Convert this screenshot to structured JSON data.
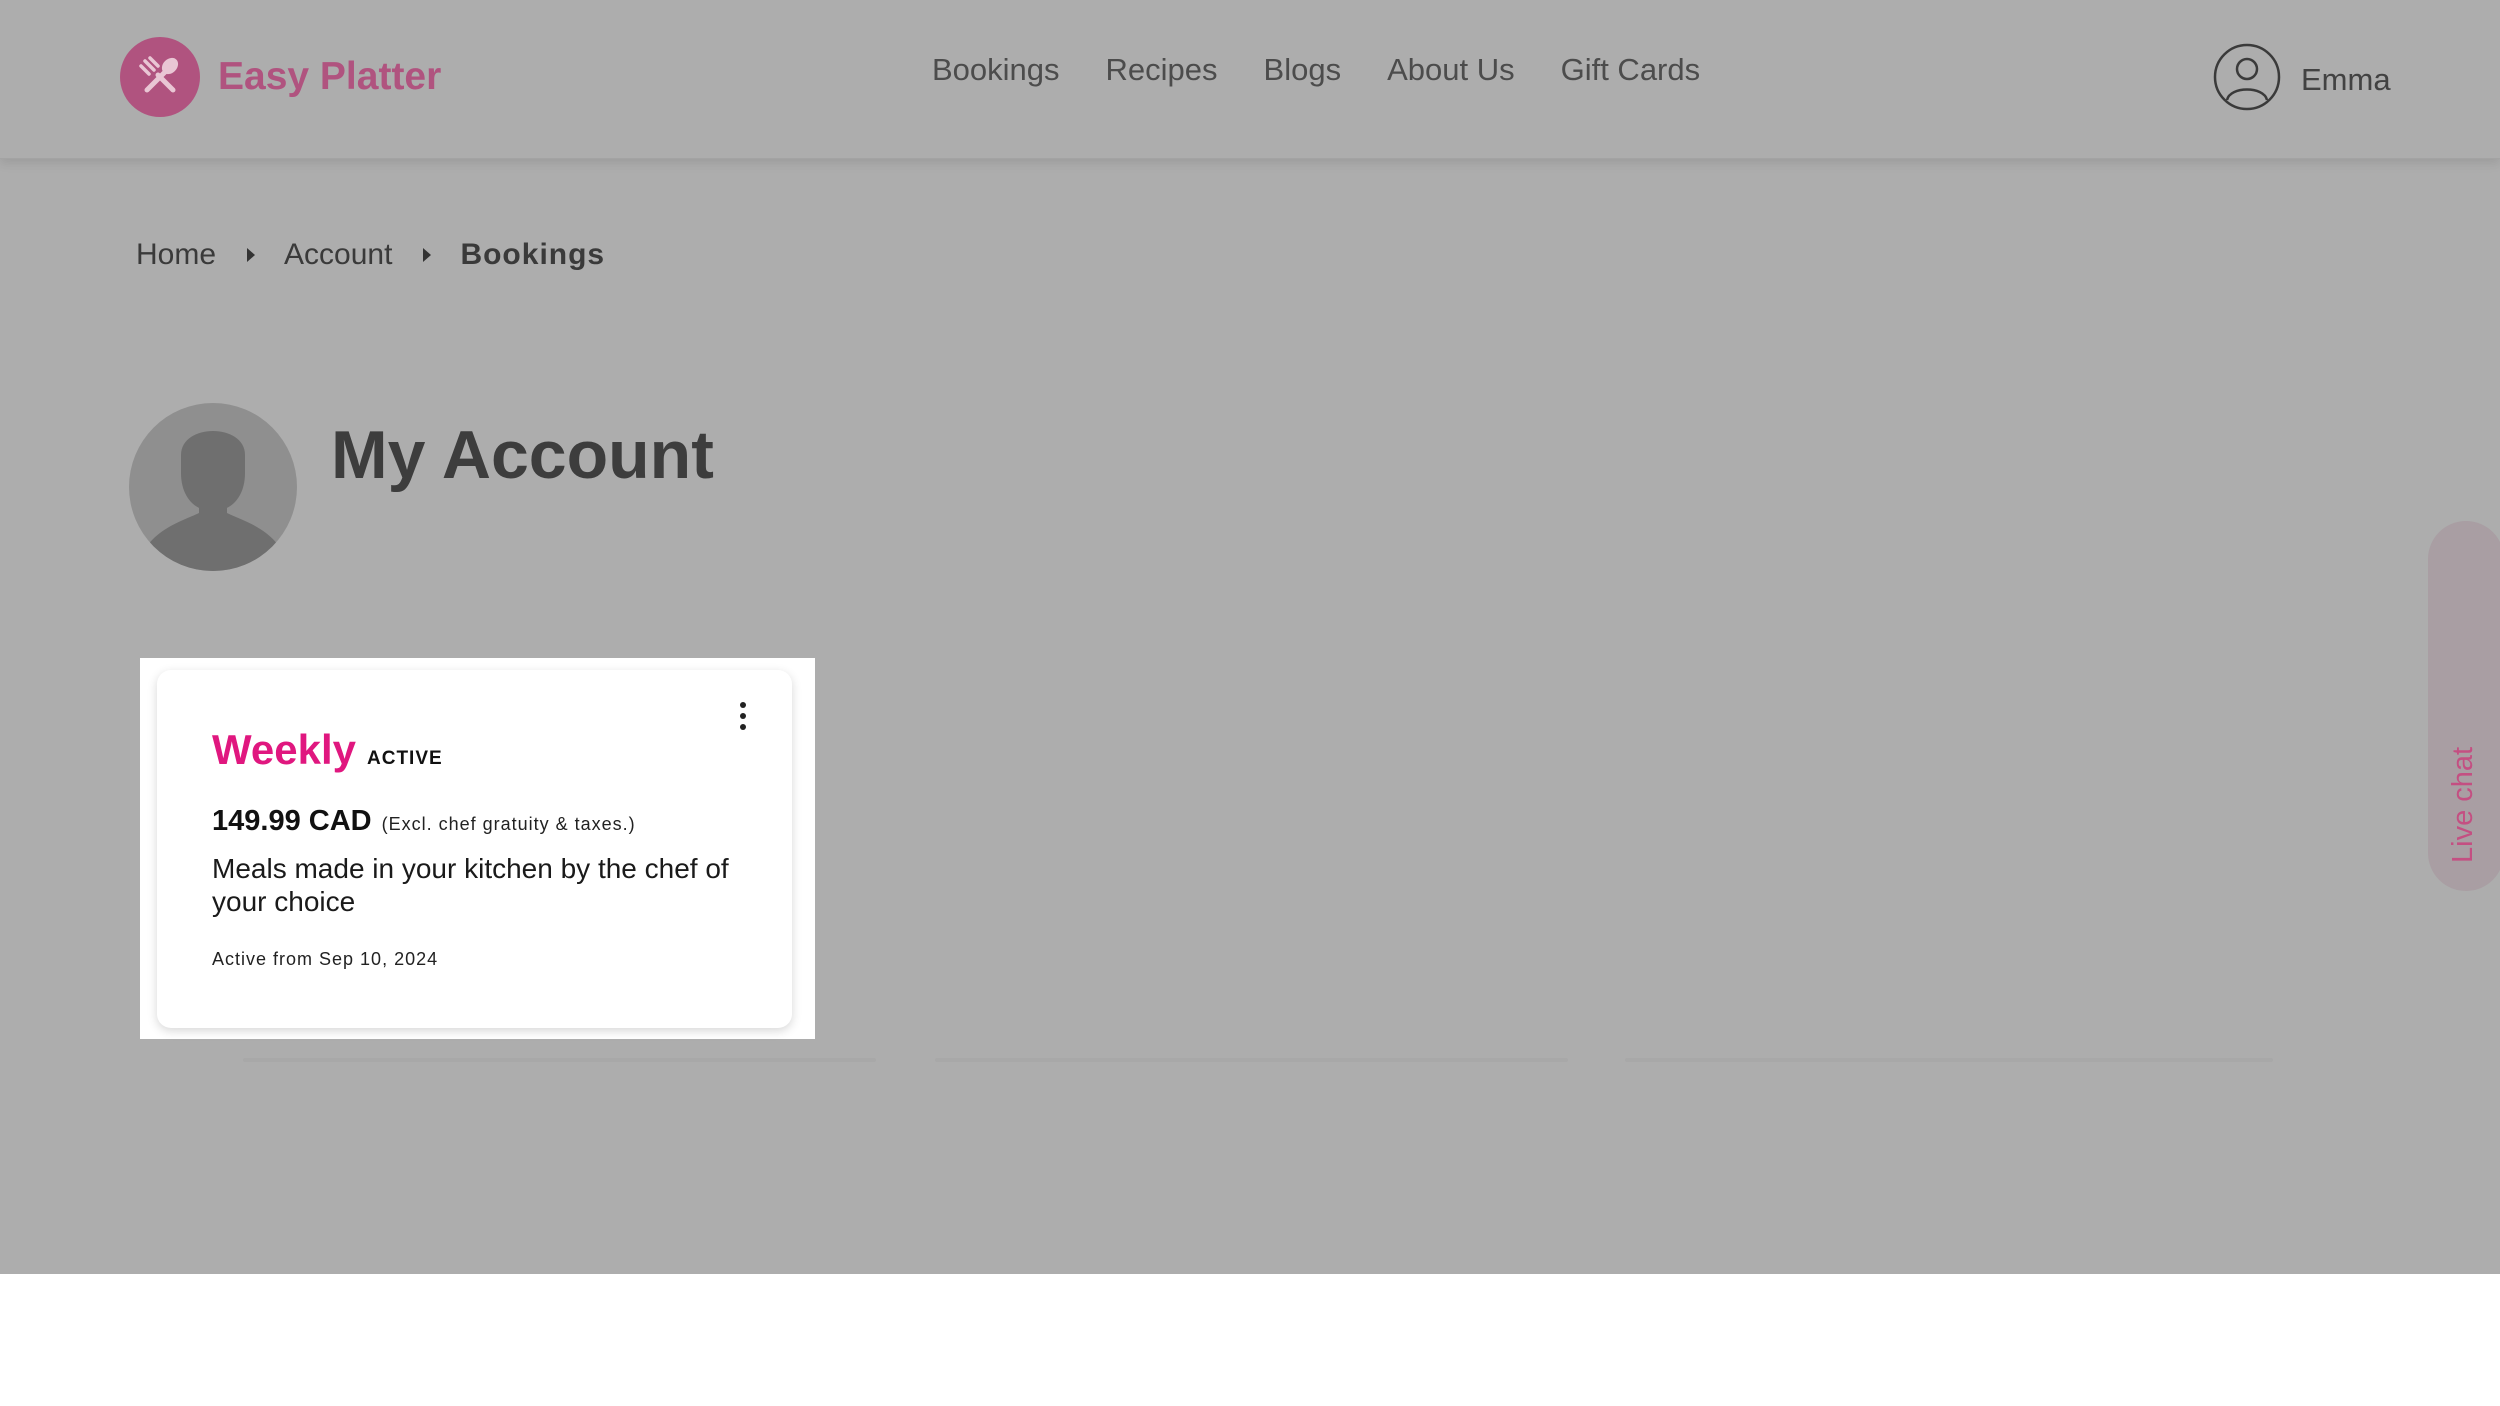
{
  "brand": {
    "name": "Easy Platter",
    "logo_icon": "fork-spoon-icon",
    "accent_color": "#b0537f"
  },
  "nav": {
    "items": [
      {
        "label": "Bookings"
      },
      {
        "label": "Recipes"
      },
      {
        "label": "Blogs"
      },
      {
        "label": "About Us"
      },
      {
        "label": "Gift Cards"
      }
    ]
  },
  "user": {
    "name": "Emma",
    "icon": "user-circle-icon"
  },
  "breadcrumb": {
    "items": [
      "Home",
      "Account",
      "Bookings"
    ]
  },
  "account": {
    "title": "My Account",
    "avatar_icon": "default-avatar-icon"
  },
  "booking_card": {
    "plan_name": "Weekly",
    "status": "ACTIVE",
    "price": "149.99 CAD",
    "price_note": "(Excl. chef gratuity & taxes.)",
    "description": "Meals made in your kitchen by the chef of your choice",
    "active_from": "Active from Sep 10, 2024",
    "plan_color": "#e0177f",
    "menu_icon": "kebab-menu-icon"
  },
  "live_chat": {
    "label": "Live chat",
    "color": "#c44f82"
  },
  "colors": {
    "overlay_gray": "#adadad",
    "page_white": "#ffffff"
  }
}
